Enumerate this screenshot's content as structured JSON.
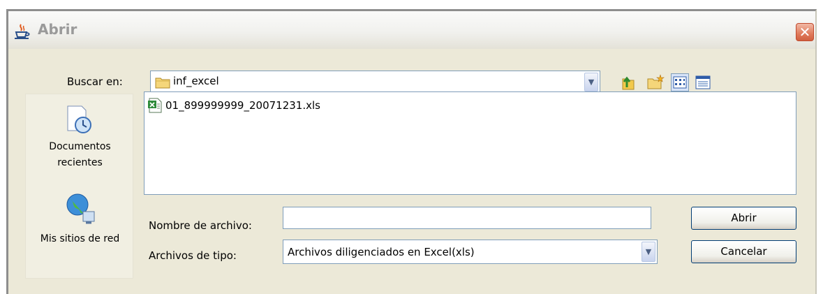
{
  "window": {
    "title": "Abrir",
    "close_symbol": "✕"
  },
  "lookin": {
    "label": "Buscar en:",
    "value": "inf_excel",
    "arrow": "▼"
  },
  "toolbar": {
    "icons": [
      "up-folder-icon",
      "new-folder-icon",
      "list-view-icon",
      "details-view-icon"
    ]
  },
  "places": [
    {
      "label_line1": "Documentos",
      "label_line2": "recientes",
      "icon": "recent-documents-icon"
    },
    {
      "label_line1": "Mis sitios de red",
      "label_line2": "",
      "icon": "network-places-icon"
    }
  ],
  "files": [
    {
      "name": "01_899999999_20071231.xls",
      "icon": "excel-file-icon"
    }
  ],
  "filename": {
    "label": "Nombre de archivo:",
    "value": ""
  },
  "filetype": {
    "label": "Archivos de tipo:",
    "value": "Archivos diligenciados en Excel(xls)",
    "arrow": "▼"
  },
  "buttons": {
    "open": "Abrir",
    "cancel": "Cancelar"
  },
  "colors": {
    "background": "#ece9d8",
    "border_blue": "#7f9db9",
    "close_red": "#e07b5c"
  }
}
